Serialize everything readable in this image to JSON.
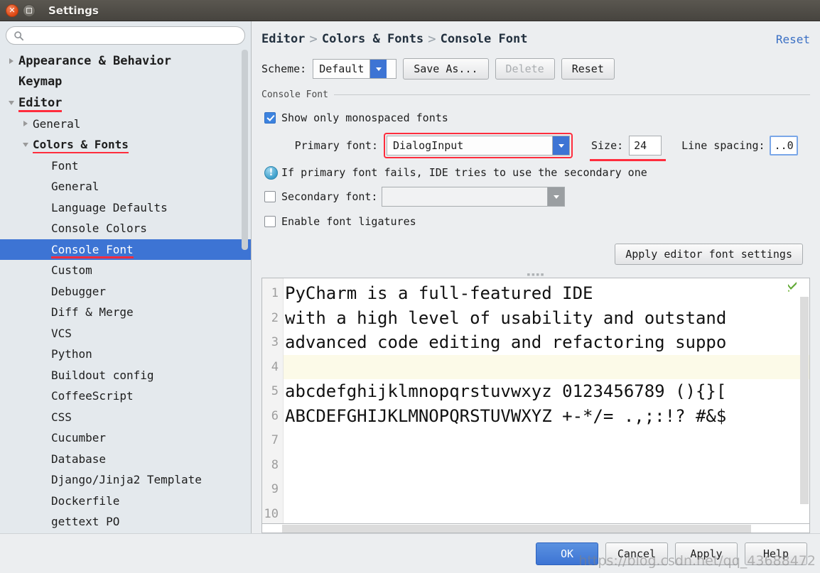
{
  "window": {
    "title": "Settings",
    "close_icon": "close-icon",
    "maximize_icon": "maximize-icon"
  },
  "search": {
    "placeholder": "",
    "value": "",
    "icon": "search-icon"
  },
  "sidebar": {
    "items": [
      {
        "label": "Appearance & Behavior",
        "level": 0,
        "twisty": "right",
        "style": "bold",
        "selected": false,
        "underlined": false
      },
      {
        "label": "Keymap",
        "level": 0,
        "twisty": "none",
        "style": "bold",
        "selected": false,
        "underlined": false
      },
      {
        "label": "Editor",
        "level": 0,
        "twisty": "down",
        "style": "bold",
        "selected": false,
        "underlined": true
      },
      {
        "label": "General",
        "level": 1,
        "twisty": "right",
        "style": "normal",
        "selected": false,
        "underlined": false
      },
      {
        "label": "Colors & Fonts",
        "level": 1,
        "twisty": "down",
        "style": "bold",
        "selected": false,
        "underlined": true
      },
      {
        "label": "Font",
        "level": 2,
        "twisty": "none",
        "style": "normal",
        "selected": false,
        "underlined": false
      },
      {
        "label": "General",
        "level": 2,
        "twisty": "none",
        "style": "normal",
        "selected": false,
        "underlined": false
      },
      {
        "label": "Language Defaults",
        "level": 2,
        "twisty": "none",
        "style": "normal",
        "selected": false,
        "underlined": false
      },
      {
        "label": "Console Colors",
        "level": 2,
        "twisty": "none",
        "style": "normal",
        "selected": false,
        "underlined": false
      },
      {
        "label": "Console Font",
        "level": 2,
        "twisty": "none",
        "style": "normal",
        "selected": true,
        "underlined": true
      },
      {
        "label": "Custom",
        "level": 2,
        "twisty": "none",
        "style": "normal",
        "selected": false,
        "underlined": false
      },
      {
        "label": "Debugger",
        "level": 2,
        "twisty": "none",
        "style": "normal",
        "selected": false,
        "underlined": false
      },
      {
        "label": "Diff & Merge",
        "level": 2,
        "twisty": "none",
        "style": "normal",
        "selected": false,
        "underlined": false
      },
      {
        "label": "VCS",
        "level": 2,
        "twisty": "none",
        "style": "normal",
        "selected": false,
        "underlined": false
      },
      {
        "label": "Python",
        "level": 2,
        "twisty": "none",
        "style": "normal",
        "selected": false,
        "underlined": false
      },
      {
        "label": "Buildout config",
        "level": 2,
        "twisty": "none",
        "style": "normal",
        "selected": false,
        "underlined": false
      },
      {
        "label": "CoffeeScript",
        "level": 2,
        "twisty": "none",
        "style": "normal",
        "selected": false,
        "underlined": false
      },
      {
        "label": "CSS",
        "level": 2,
        "twisty": "none",
        "style": "normal",
        "selected": false,
        "underlined": false
      },
      {
        "label": "Cucumber",
        "level": 2,
        "twisty": "none",
        "style": "normal",
        "selected": false,
        "underlined": false
      },
      {
        "label": "Database",
        "level": 2,
        "twisty": "none",
        "style": "normal",
        "selected": false,
        "underlined": false
      },
      {
        "label": "Django/Jinja2 Template",
        "level": 2,
        "twisty": "none",
        "style": "normal",
        "selected": false,
        "underlined": false
      },
      {
        "label": "Dockerfile",
        "level": 2,
        "twisty": "none",
        "style": "normal",
        "selected": false,
        "underlined": false
      },
      {
        "label": "gettext PO",
        "level": 2,
        "twisty": "none",
        "style": "normal",
        "selected": false,
        "underlined": false
      }
    ]
  },
  "content": {
    "breadcrumb": [
      "Editor",
      "Colors & Fonts",
      "Console Font"
    ],
    "breadcrumb_separator": ">",
    "reset_link": "Reset",
    "scheme_label": "Scheme:",
    "scheme_value": "Default",
    "save_as_button": "Save As...",
    "delete_button": "Delete",
    "reset_button": "Reset",
    "group_title": "Console Font",
    "show_monospaced_label": "Show only monospaced fonts",
    "show_monospaced_checked": true,
    "primary_font_label": "Primary font:",
    "primary_font_value": "DialogInput",
    "size_label": "Size:",
    "size_value": "24",
    "line_spacing_label": "Line spacing:",
    "line_spacing_value": "..0",
    "hint_text": "If primary font fails, IDE tries to use the secondary one",
    "hint_icon": "info-icon",
    "secondary_font_label": "Secondary font:",
    "secondary_font_value": "",
    "secondary_font_checked": false,
    "ligatures_label": "Enable font ligatures",
    "ligatures_checked": false,
    "apply_editor_font_button": "Apply editor font settings"
  },
  "preview": {
    "line_numbers": [
      "1",
      "2",
      "3",
      "4",
      "5",
      "6",
      "7",
      "8",
      "9",
      "10"
    ],
    "lines": [
      "PyCharm is a full-featured IDE",
      "with a high level of usability and outstand",
      "advanced code editing and refactoring suppo",
      "",
      "abcdefghijklmnopqrstuvwxyz 0123456789 (){}[",
      "ABCDEFGHIJKLMNOPQRSTUVWXYZ +-*/= .,;:!? #&$",
      "",
      "",
      "",
      ""
    ],
    "caret_line_index": 3,
    "validation_icon": "checkmark-icon"
  },
  "footer": {
    "ok_button": "OK",
    "cancel_button": "Cancel",
    "apply_button": "Apply",
    "help_button": "Help",
    "watermark": "https://blog.csdn.net/qq_43688472"
  },
  "colors": {
    "accent": "#3d74d4",
    "highlight_red": "#ff2d3d",
    "titlebar": "#4c4a45",
    "sidebar_bg": "#e4e9ed",
    "panel_bg": "#eceef0"
  }
}
